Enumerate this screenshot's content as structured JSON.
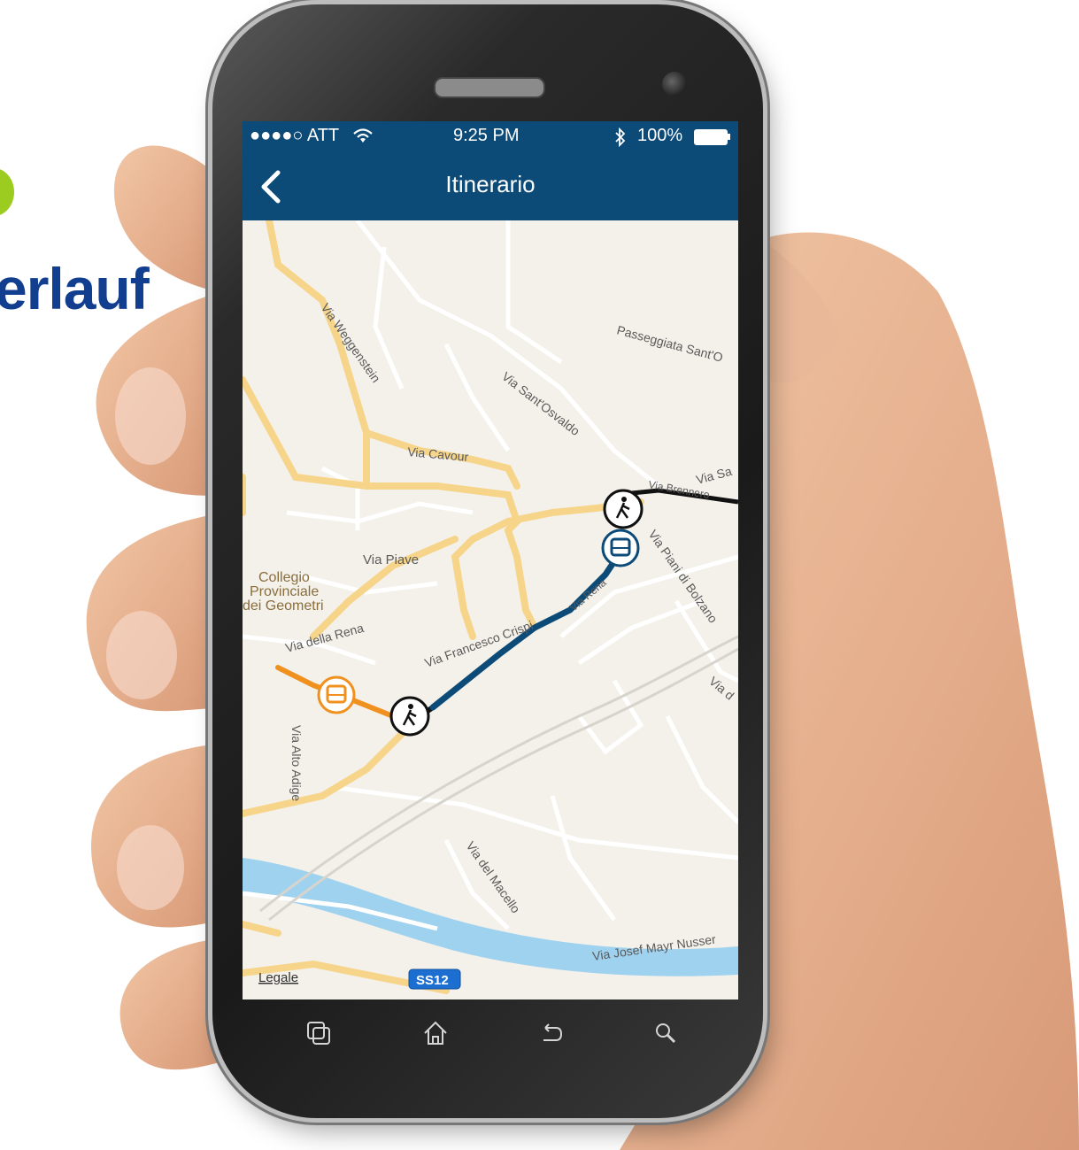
{
  "background_text": {
    "partial_title": "erlauf"
  },
  "status_bar": {
    "carrier": "●●●●○ ATT",
    "time": "9:25 PM",
    "battery": "100%"
  },
  "nav": {
    "title": "Itinerario"
  },
  "map": {
    "streets": [
      "Via Weggenstein",
      "Passeggiata Sant'O",
      "Via Sant'Osvaldo",
      "Via Cavour",
      "Via Sa",
      "Via Brennero",
      "Via Piani di Bolzano",
      "Via Piave",
      "Via Rena",
      "Via Francesco Crispi",
      "Via della Rena",
      "Via d",
      "Via Alto Adige",
      "Via del Macello",
      "Via Josef Mayr Nusser"
    ],
    "poi": [
      "Collegio",
      "Provinciale",
      "dei Geometri"
    ],
    "legal": "Legale",
    "road_badge": "SS12"
  },
  "colors": {
    "nav": "#0c4a78",
    "route_bus": "#0c4a78",
    "route_walk_orange": "#f0901e",
    "title": "#123e8f"
  }
}
